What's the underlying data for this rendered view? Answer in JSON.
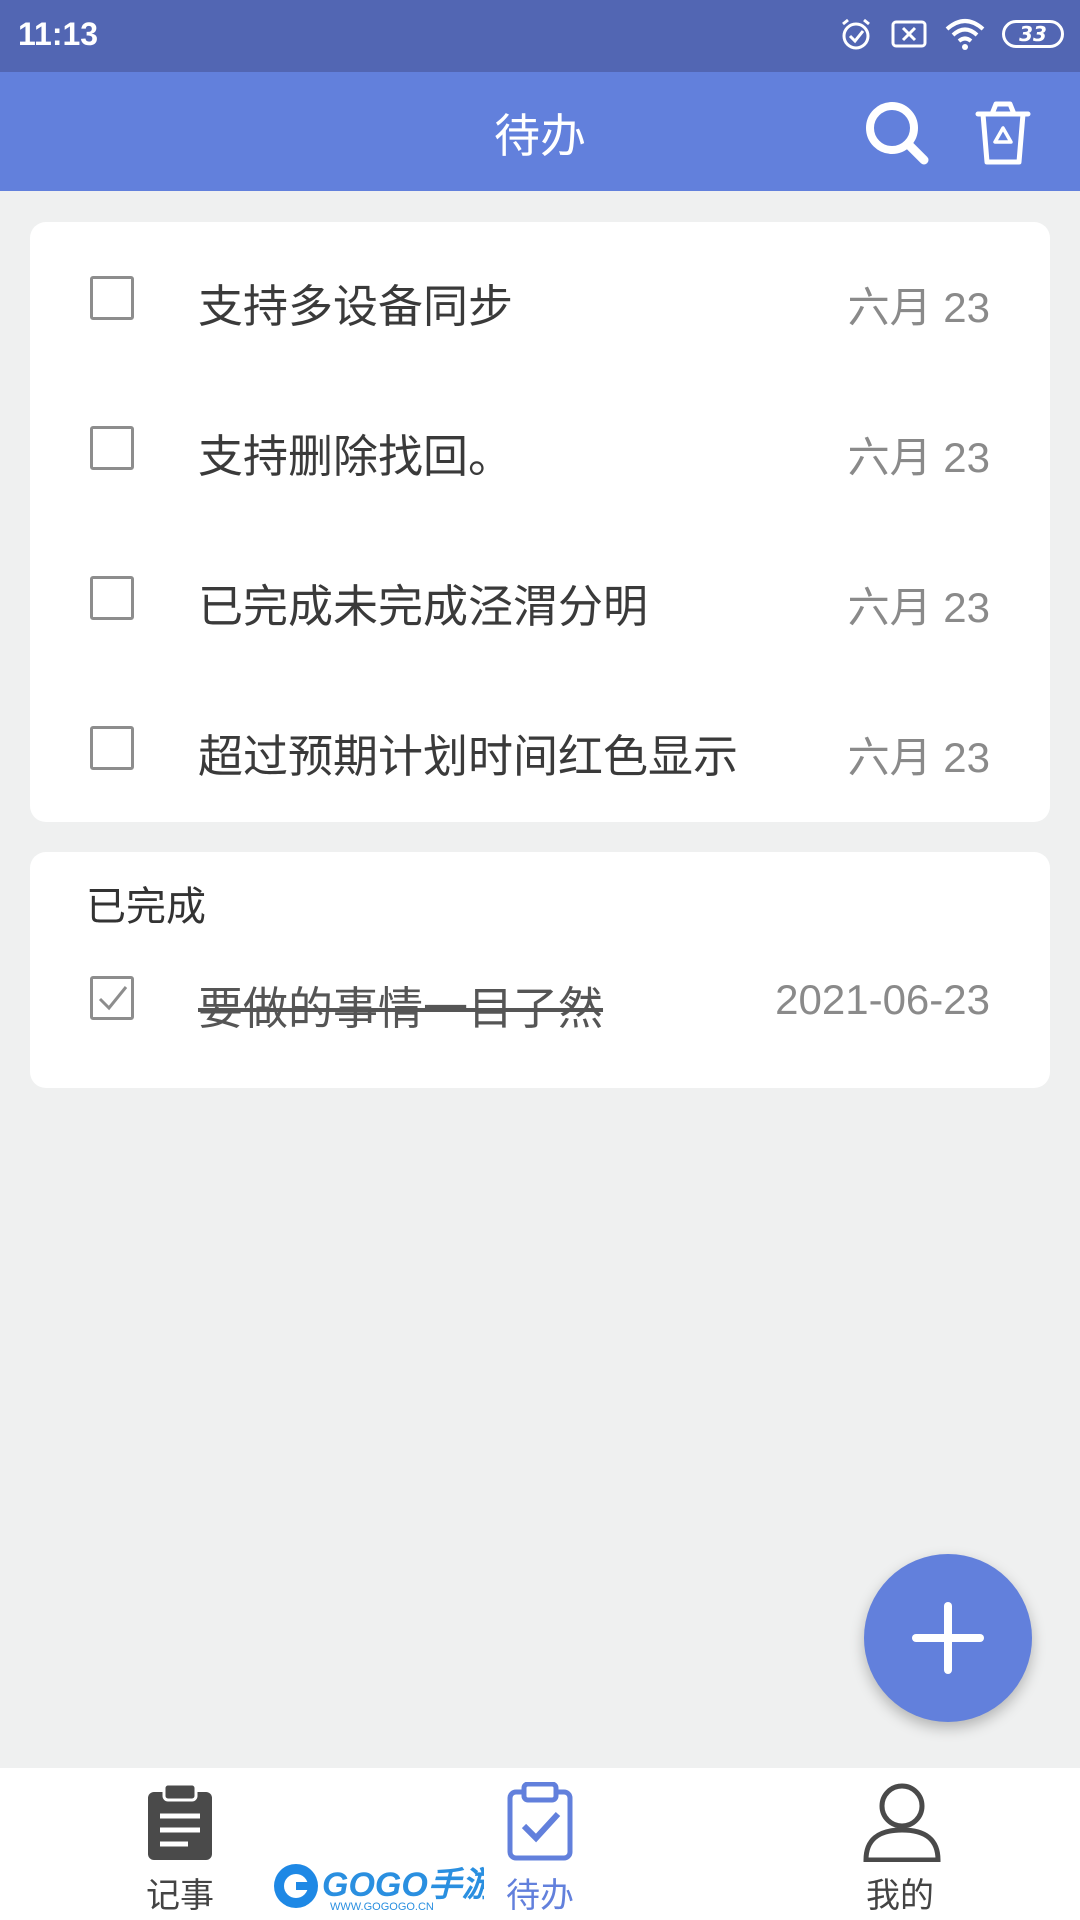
{
  "status_bar": {
    "time": "11:13",
    "battery": "33"
  },
  "app_bar": {
    "title": "待办"
  },
  "pending": [
    {
      "text": "支持多设备同步",
      "date": "六月 23"
    },
    {
      "text": "支持删除找回。",
      "date": "六月 23"
    },
    {
      "text": "已完成未完成泾渭分明",
      "date": "六月 23"
    },
    {
      "text": "超过预期计划时间红色显示",
      "date": "六月 23"
    }
  ],
  "completed": {
    "title": "已完成",
    "items": [
      {
        "text": "要做的事情一目了然",
        "date": "2021-06-23"
      }
    ]
  },
  "bottom_nav": [
    {
      "label": "记事",
      "icon": "clipboard-icon"
    },
    {
      "label": "待办",
      "icon": "clipboard-check-icon",
      "active": true
    },
    {
      "label": "我的",
      "icon": "person-icon"
    }
  ],
  "watermark": {
    "brand": "GOGO手游网",
    "url": "WWW.GOGOGO.CN"
  },
  "colors": {
    "primary": "#6280dc",
    "status_bar": "#5266b3",
    "background": "#eff0f0"
  }
}
